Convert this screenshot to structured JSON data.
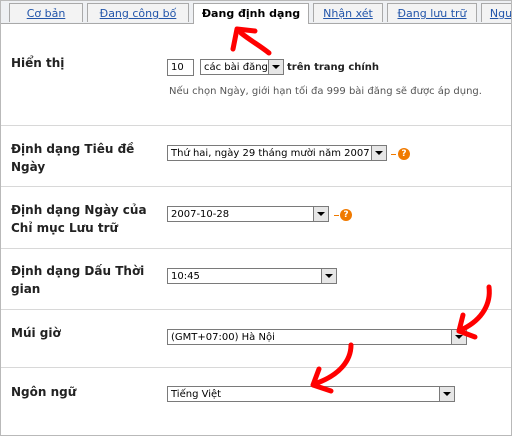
{
  "tabs": [
    {
      "label": "Cơ bản"
    },
    {
      "label": "Đang công bố"
    },
    {
      "label": "Đang định dạng",
      "active": true
    },
    {
      "label": "Nhận xét"
    },
    {
      "label": "Đang lưu trữ"
    },
    {
      "label": "Ngư"
    }
  ],
  "settings": {
    "display": {
      "label": "Hiển thị",
      "count_value": "10",
      "unit_select": "các bài đăng",
      "suffix": "trên trang chính",
      "note": "Nếu chọn Ngày, giới hạn tối đa 999 bài đăng sẽ được áp dụng."
    },
    "date_header": {
      "label_line1": "Định dạng Tiêu đề",
      "label_line2": "Ngày",
      "value": "Thứ hai, ngày 29 tháng mười năm 2007",
      "help": "?"
    },
    "archive_date": {
      "label_line1": "Định dạng Ngày của",
      "label_line2": "Chỉ mục Lưu trữ",
      "value": "2007-10-28",
      "help": "?"
    },
    "timestamp": {
      "label_line1": "Định dạng Dấu Thời",
      "label_line2": "gian",
      "value": "10:45"
    },
    "timezone": {
      "label": "Múi giờ",
      "value": "(GMT+07:00) Hà Nội"
    },
    "language": {
      "label": "Ngôn ngữ",
      "value": "Tiếng Việt"
    }
  },
  "colors": {
    "annotation_arrow": "#ff0000",
    "help_icon": "#f07a00",
    "link": "#2255aa"
  }
}
